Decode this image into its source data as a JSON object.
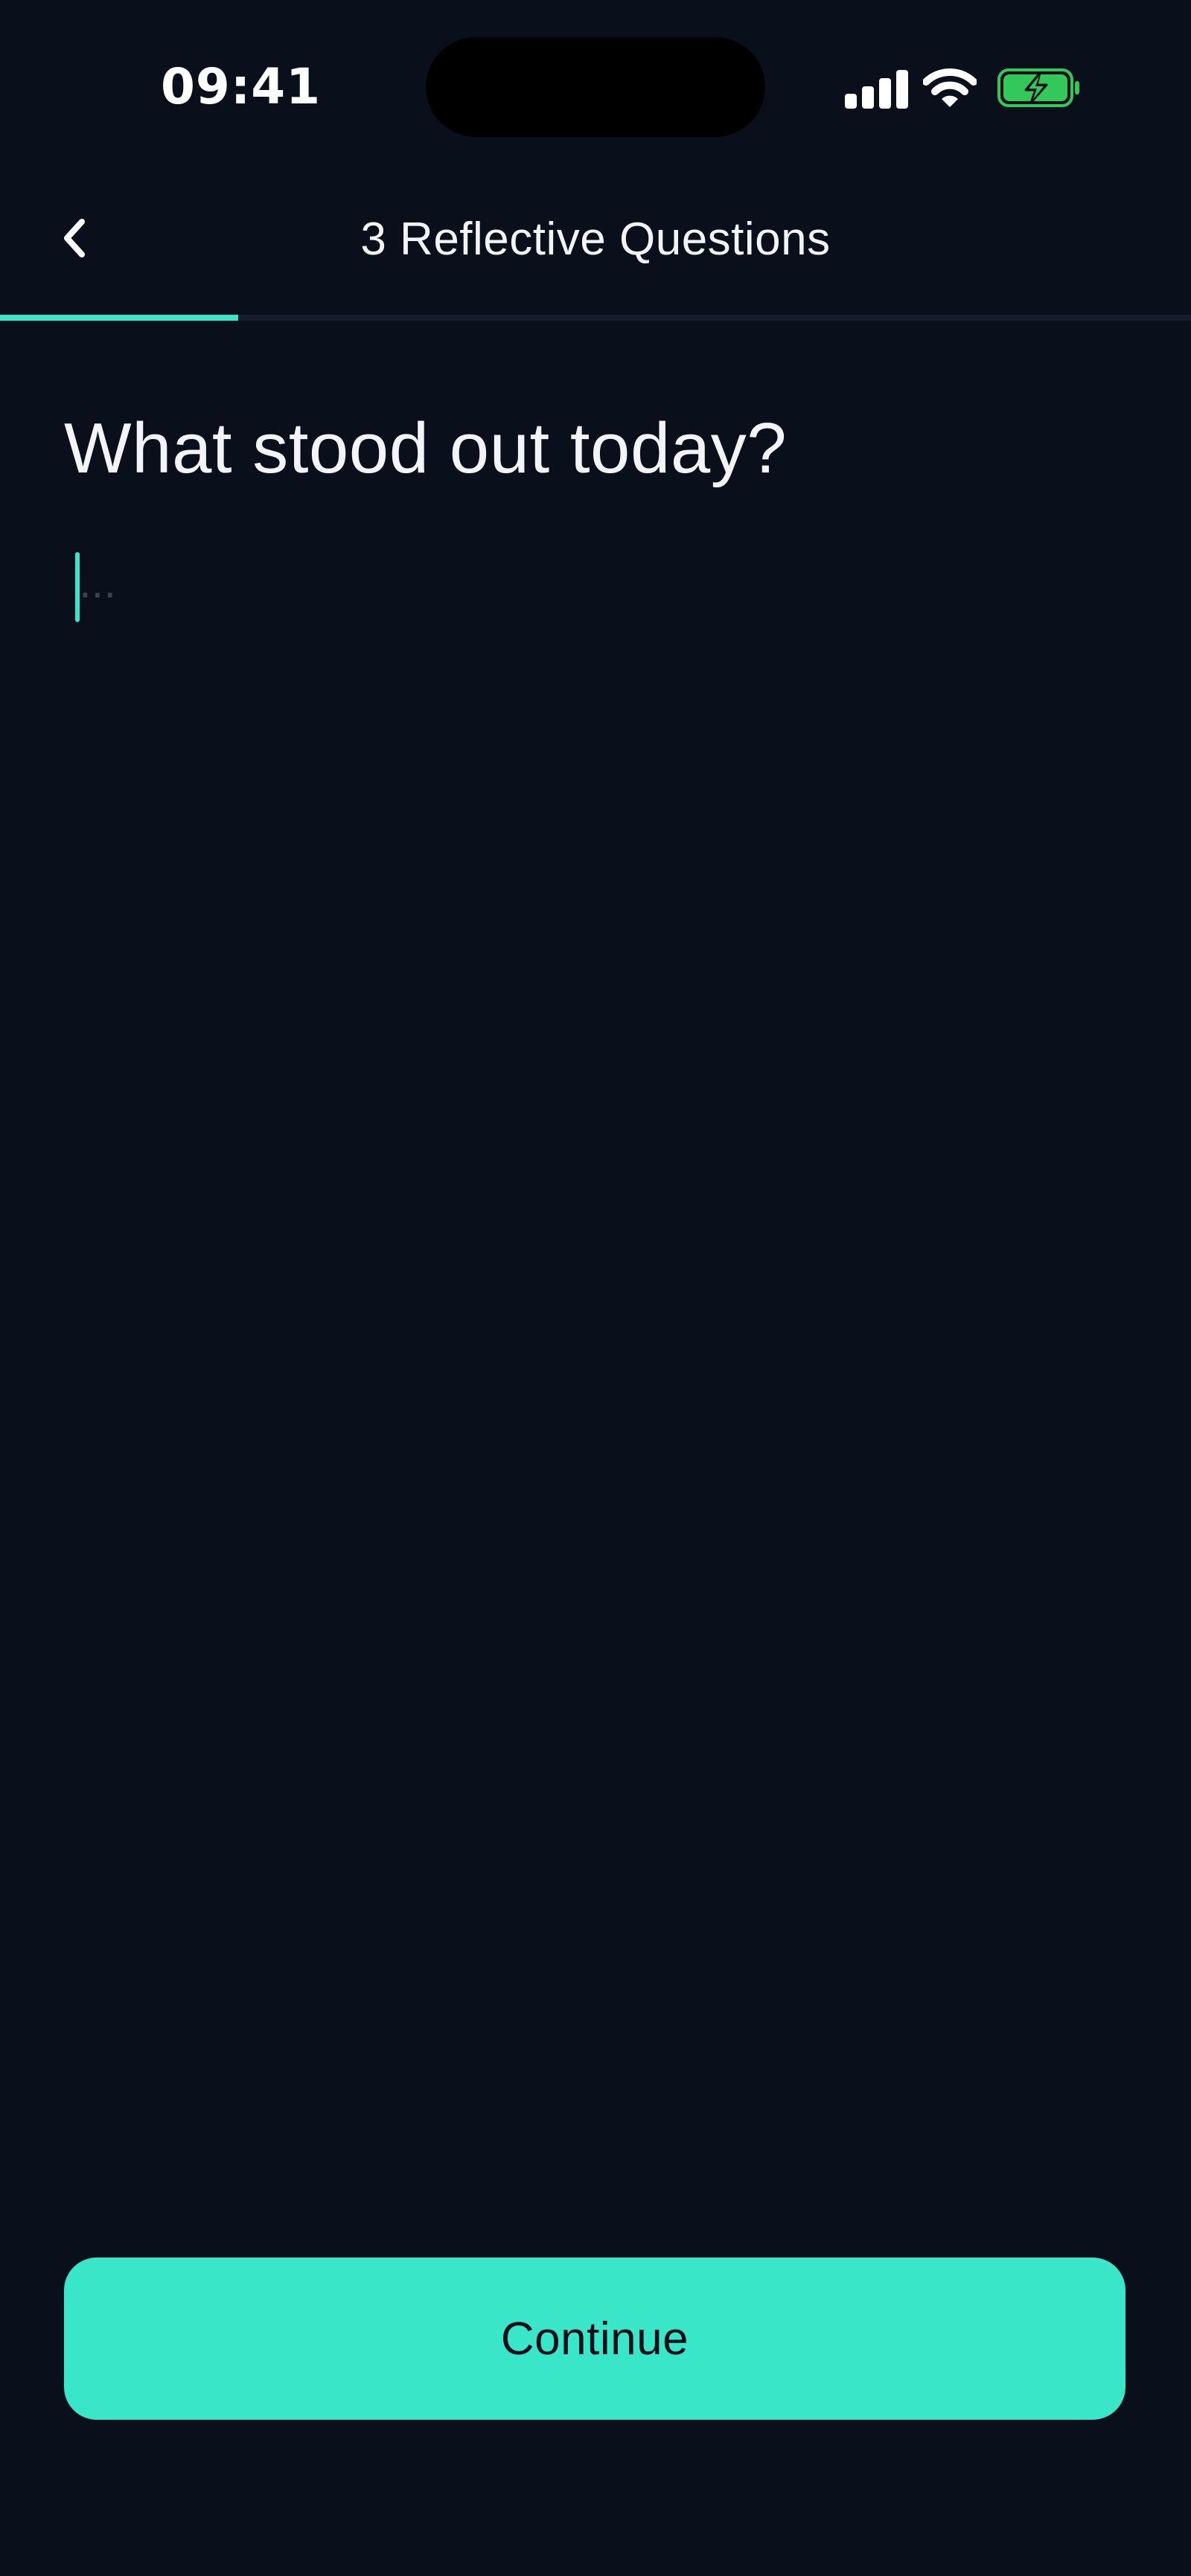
{
  "status_bar": {
    "time": "09:41",
    "icons": [
      "cellular-signal-icon",
      "wifi-icon",
      "battery-charging-icon"
    ]
  },
  "header": {
    "title": "3 Reflective Questions",
    "back_icon": "chevron-left-icon",
    "progress": 0.2
  },
  "question": {
    "text": "What stood out today?"
  },
  "answer": {
    "value": "",
    "placeholder": "..."
  },
  "footer": {
    "continue_label": "Continue"
  },
  "colors": {
    "background": "#0a0f1c",
    "accent": "#39e6c8",
    "text": "#f2f4f8",
    "battery": "#34c759"
  }
}
